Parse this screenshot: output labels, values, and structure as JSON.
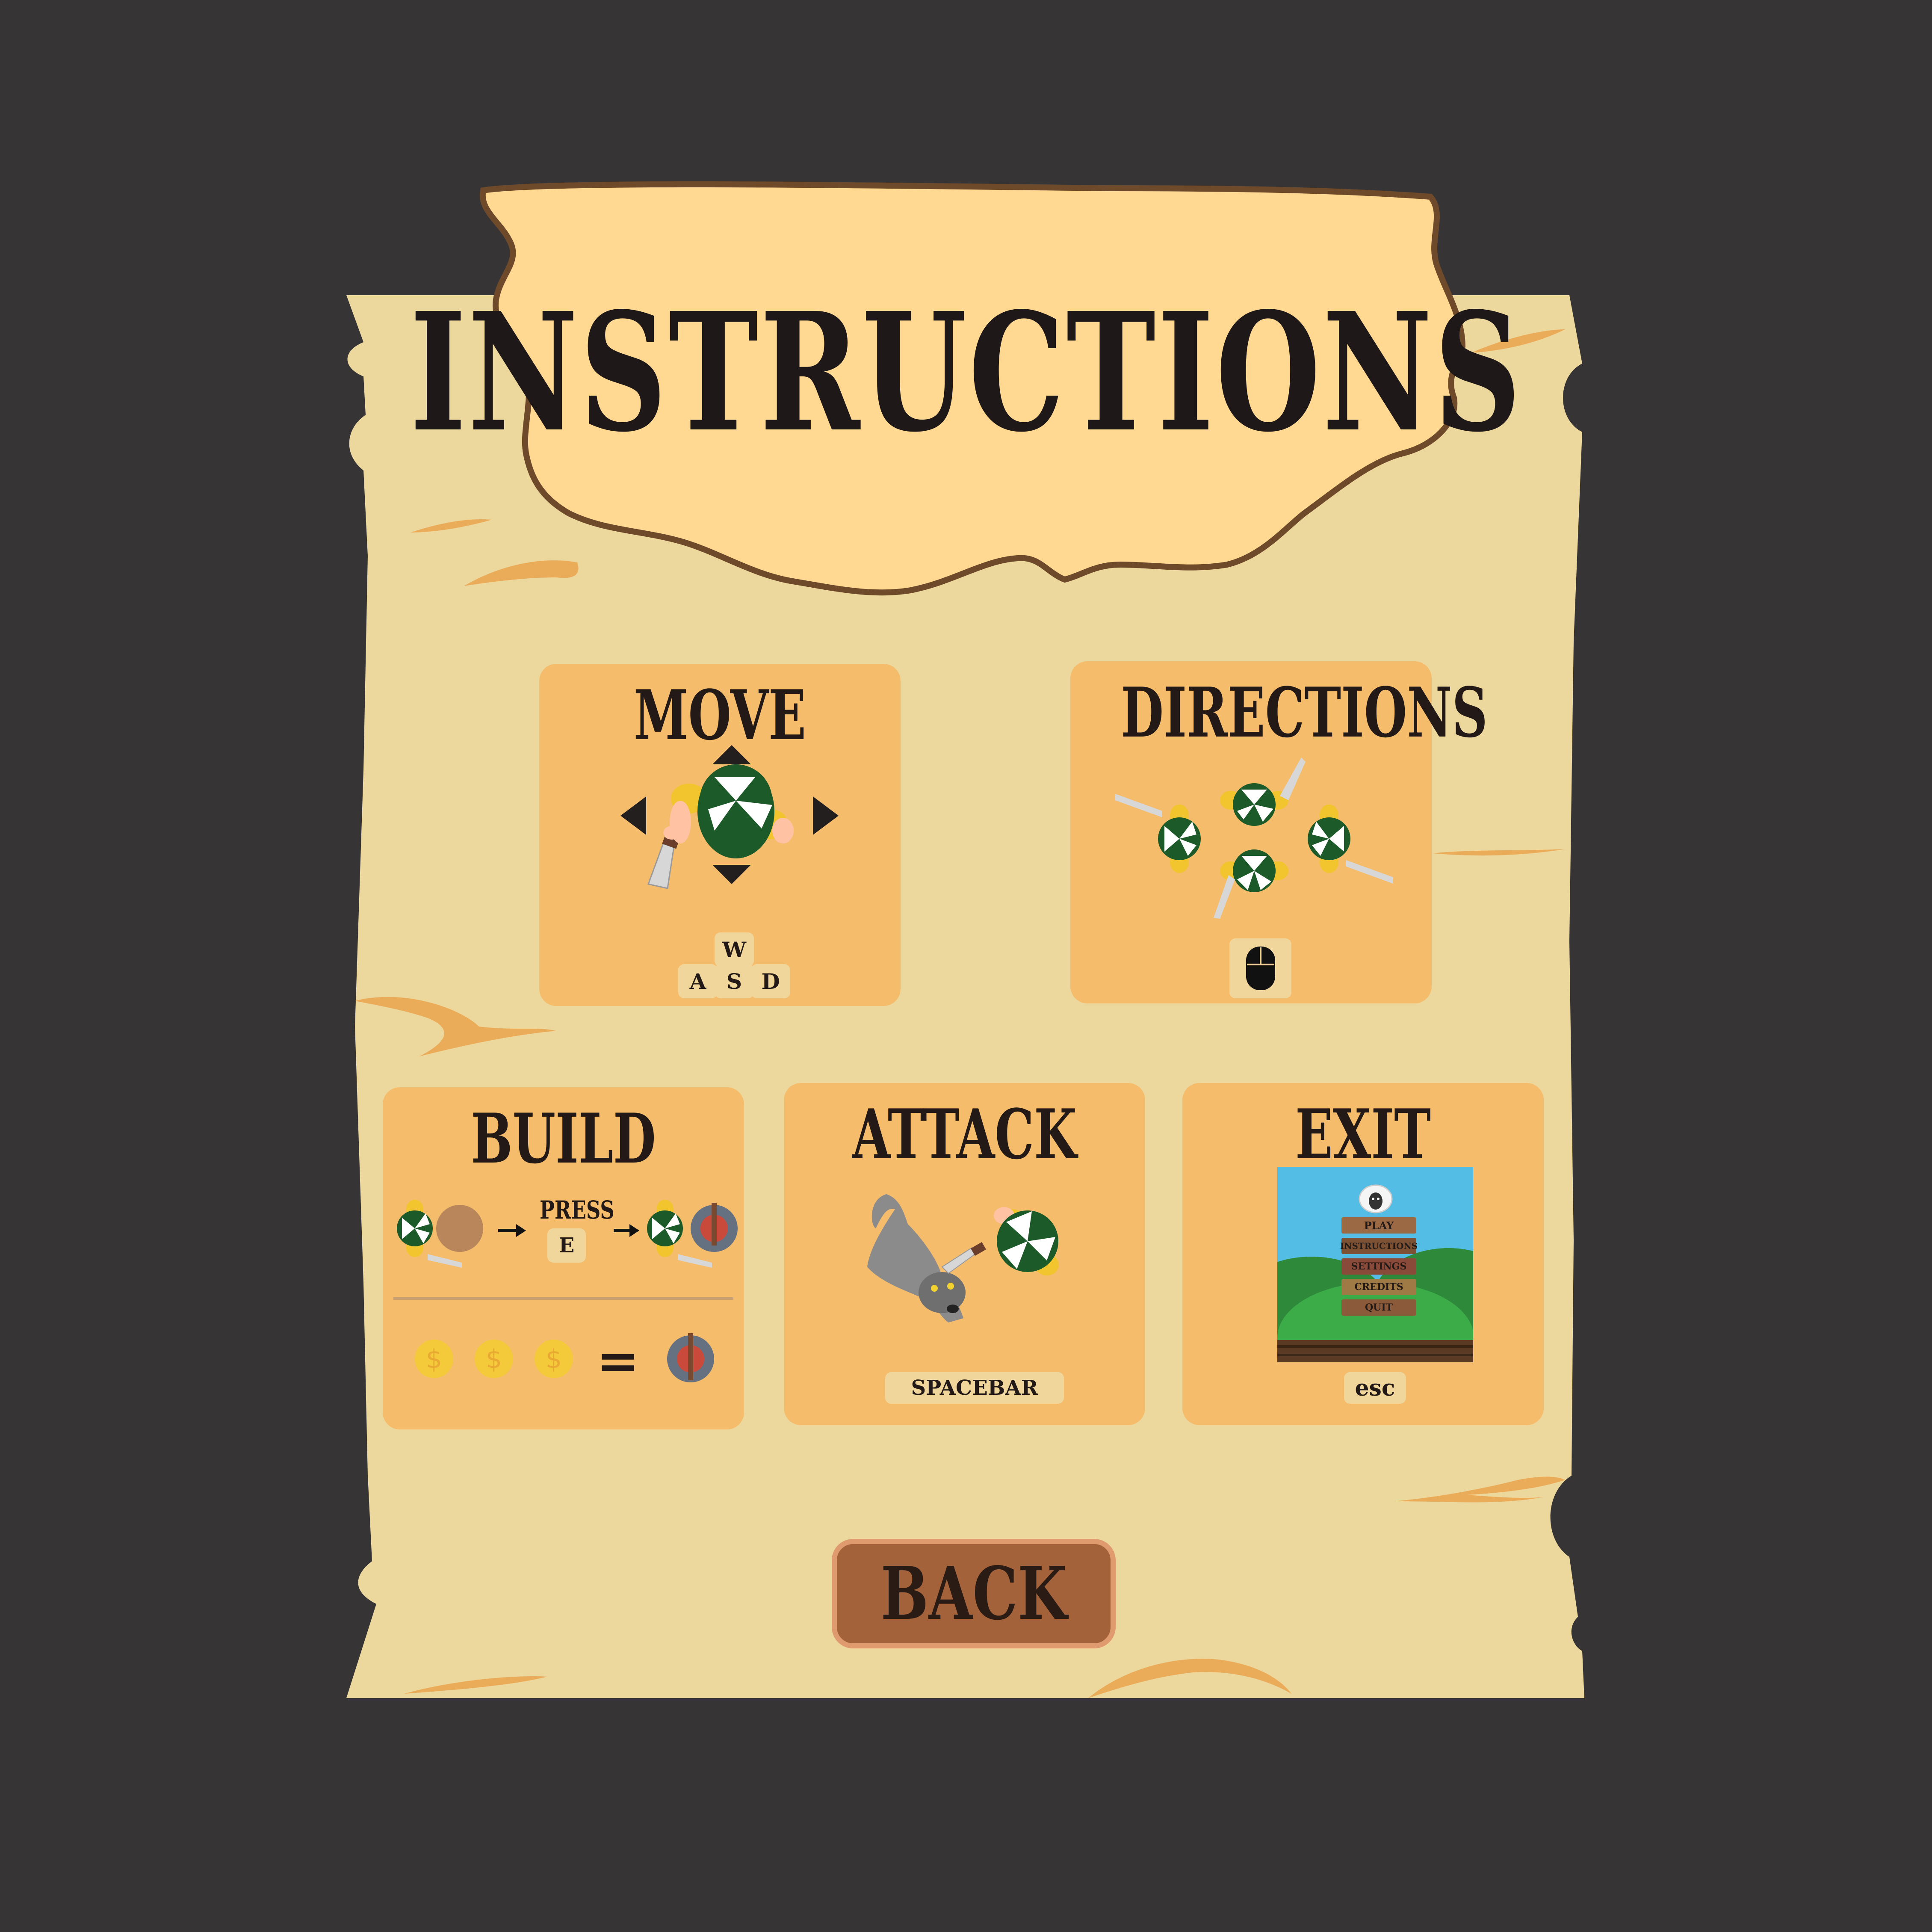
{
  "screen": {
    "title": "INSTRUCTIONS",
    "background_color": "#363435",
    "scroll_color": "#ecd79d",
    "sign_color": "#ffd991",
    "panel_color": "#f5bc6b"
  },
  "panels": {
    "move": {
      "title": "MOVE",
      "keys": [
        "W",
        "A",
        "S",
        "D"
      ]
    },
    "directions": {
      "title": "DIRECTIONS",
      "input_icon": "mouse-icon"
    },
    "build": {
      "title": "BUILD",
      "press_label": "PRESS",
      "key": "E",
      "cost_equals": "="
    },
    "attack": {
      "title": "ATTACK",
      "key": "SPACEBAR"
    },
    "exit": {
      "title": "EXIT",
      "key": "esc",
      "menu_preview": [
        "PLAY",
        "INSTRUCTIONS",
        "SETTINGS",
        "CREDITS",
        "QUIT"
      ]
    }
  },
  "back_button": {
    "label": "BACK",
    "color": "#a4623a"
  }
}
